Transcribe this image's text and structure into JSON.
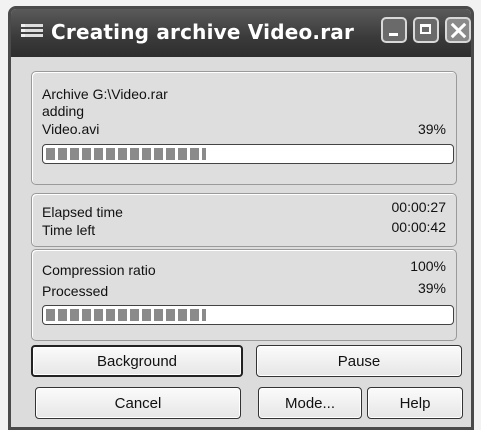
{
  "window": {
    "title": "Creating archive Video.rar",
    "controls": [
      "minimize",
      "maximize",
      "close"
    ]
  },
  "archive": {
    "archive_line": "Archive G:\\Video.rar",
    "action": "adding",
    "file_name": "Video.avi",
    "file_percent": "39%",
    "file_progress": 0.39
  },
  "timing": {
    "elapsed_label": "Elapsed time",
    "elapsed_value": "00:00:27",
    "left_label": "Time left",
    "left_value": "00:00:42"
  },
  "stats": {
    "ratio_label": "Compression ratio",
    "ratio_value": "100%",
    "processed_label": "Processed",
    "processed_value": "39%",
    "processed_progress": 0.39
  },
  "buttons": {
    "background": "Background",
    "pause": "Pause",
    "cancel": "Cancel",
    "mode": "Mode...",
    "help": "Help"
  },
  "icons": {
    "app": "archive-list-icon",
    "minimize": "minimize-icon",
    "maximize": "maximize-icon",
    "close": "close-icon"
  }
}
